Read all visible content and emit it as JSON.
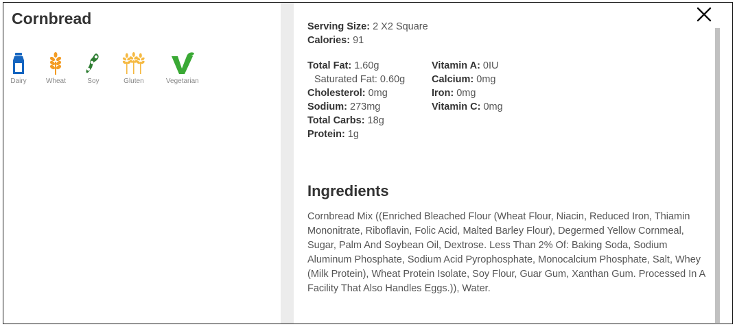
{
  "item": {
    "title": "Cornbread"
  },
  "allergens": [
    {
      "label": "Dairy",
      "icon": "milk-bottle-icon",
      "color": "#1565c0"
    },
    {
      "label": "Wheat",
      "icon": "wheat-icon",
      "color": "#f39c24"
    },
    {
      "label": "Soy",
      "icon": "soybean-icon",
      "color": "#2e7d32"
    },
    {
      "label": "Gluten",
      "icon": "grain-stalks-icon",
      "color": "#f5b942"
    },
    {
      "label": "Vegetarian",
      "icon": "vegetarian-v-icon",
      "color": "#3aa935"
    }
  ],
  "nutrition": {
    "serving_label": "Serving Size:",
    "serving_value": " 2 X2 Square",
    "calories_label": "Calories:",
    "calories_value": " 91",
    "col1": [
      {
        "label": "Total Fat:",
        "value": " 1.60g"
      },
      {
        "label": "",
        "value": "Saturated Fat: 0.60g"
      },
      {
        "label": "Cholesterol:",
        "value": " 0mg"
      },
      {
        "label": "Sodium:",
        "value": " 273mg"
      },
      {
        "label": "Total Carbs:",
        "value": " 18g"
      },
      {
        "label": "Protein:",
        "value": " 1g"
      }
    ],
    "col2": [
      {
        "label": "Vitamin A:",
        "value": " 0IU"
      },
      {
        "label": "Calcium:",
        "value": " 0mg"
      },
      {
        "label": "Iron:",
        "value": " 0mg"
      },
      {
        "label": "Vitamin C:",
        "value": " 0mg"
      }
    ]
  },
  "ingredients": {
    "heading": "Ingredients",
    "text": "Cornbread Mix ((Enriched Bleached Flour (Wheat Flour, Niacin, Reduced Iron, Thiamin Mononitrate, Riboflavin, Folic Acid, Malted Barley Flour), Degermed Yellow Cornmeal, Sugar, Palm And Soybean Oil, Dextrose. Less Than 2% Of: Baking Soda, Sodium Aluminum Phosphate, Sodium Acid Pyrophosphate, Monocalcium Phosphate, Salt, Whey (Milk Protein), Wheat Protein Isolate, Soy Flour, Guar Gum, Xanthan Gum. Processed In A Facility That Also Handles Eggs.)), Water."
  }
}
